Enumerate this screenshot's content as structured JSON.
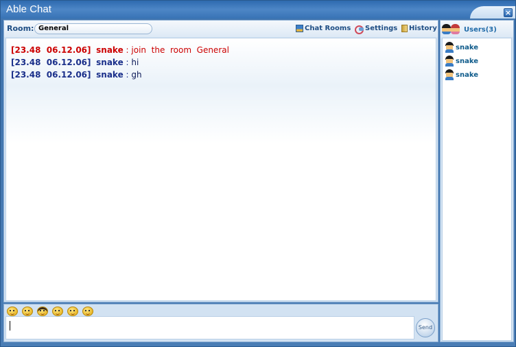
{
  "window": {
    "title": "Able Chat"
  },
  "toolbar": {
    "room_label": "Room:",
    "room_value": "General",
    "links": [
      {
        "label": "Chat Rooms",
        "icon": "chat-rooms-icon"
      },
      {
        "label": "Settings",
        "icon": "settings-icon"
      },
      {
        "label": "History",
        "icon": "history-icon"
      }
    ]
  },
  "messages": [
    {
      "timestamp": "[23.48  06.12.06]",
      "nick": "snake",
      "sep": " : ",
      "text": "join  the  room  General",
      "style": "system",
      "color": "#cc0000"
    },
    {
      "timestamp": "[23.48  06.12.06]",
      "nick": "snake",
      "sep": " : ",
      "text": "hi",
      "style": "user",
      "color": "#1a2f8a"
    },
    {
      "timestamp": "[23.48  06.12.06]",
      "nick": "snake",
      "sep": " : ",
      "text": "gh",
      "style": "user",
      "color": "#1a2f8a"
    }
  ],
  "users": {
    "title": "Users(3)",
    "items": [
      {
        "name": "snake"
      },
      {
        "name": "snake"
      },
      {
        "name": "snake"
      }
    ]
  },
  "input": {
    "value": "",
    "send_label": "Send",
    "emoticons": [
      "smile-icon",
      "laugh-icon",
      "cool-icon",
      "wink-icon",
      "grin-icon",
      "sad-icon"
    ]
  }
}
